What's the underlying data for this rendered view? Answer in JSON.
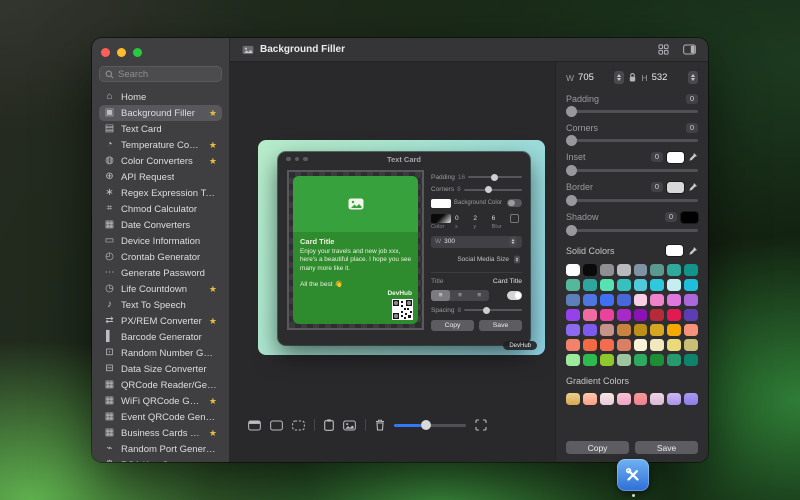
{
  "colors": {
    "accent_blue": "#3478f6",
    "star": "#e9bc3f",
    "card_green": "#2e8b2e",
    "card_green_light": "#37a13e",
    "preview_mint": "#b7ecca",
    "preview_cyan": "#8ed2e4",
    "traffic_red": "#ff5f57",
    "traffic_yellow": "#febc2e",
    "traffic_green": "#28c840"
  },
  "sidebar": {
    "search_placeholder": "Search",
    "items": [
      {
        "label": "Home",
        "icon": "home",
        "glyph": "⌂",
        "starred": false,
        "selected": false
      },
      {
        "label": "Background Filler",
        "icon": "background-filler",
        "glyph": "▣",
        "starred": true,
        "selected": true
      },
      {
        "label": "Text Card",
        "icon": "text-card",
        "glyph": "▤",
        "starred": false,
        "selected": false
      },
      {
        "label": "Temperature Converter",
        "icon": "temperature",
        "glyph": "◔",
        "starred": true,
        "selected": false
      },
      {
        "label": "Color Converters",
        "icon": "color-palette",
        "glyph": "◍",
        "starred": true,
        "selected": false
      },
      {
        "label": "API Request",
        "icon": "api-globe",
        "glyph": "⊕",
        "starred": false,
        "selected": false
      },
      {
        "label": "Regex Expression Test",
        "icon": "regex",
        "glyph": "∗",
        "starred": false,
        "selected": false
      },
      {
        "label": "Chmod Calculator",
        "icon": "chmod",
        "glyph": "⌗",
        "starred": false,
        "selected": false
      },
      {
        "label": "Date Converters",
        "icon": "calendar",
        "glyph": "▦",
        "starred": false,
        "selected": false
      },
      {
        "label": "Device Information",
        "icon": "device-monitor",
        "glyph": "▭",
        "starred": false,
        "selected": false
      },
      {
        "label": "Crontab Generator",
        "icon": "crontab-clock",
        "glyph": "◴",
        "starred": false,
        "selected": false
      },
      {
        "label": "Generate Password",
        "icon": "password-dots",
        "glyph": "⋯",
        "starred": false,
        "selected": false
      },
      {
        "label": "Life Countdown",
        "icon": "countdown-clock",
        "glyph": "◷",
        "starred": true,
        "selected": false
      },
      {
        "label": "Text To Speech",
        "icon": "speech",
        "glyph": "♪",
        "starred": false,
        "selected": false
      },
      {
        "label": "PX/REM Converter",
        "icon": "px-rem",
        "glyph": "⇄",
        "starred": true,
        "selected": false
      },
      {
        "label": "Barcode Generator",
        "icon": "barcode",
        "glyph": "▌",
        "starred": false,
        "selected": false
      },
      {
        "label": "Random Number Generator",
        "icon": "random-number",
        "glyph": "⊡",
        "starred": false,
        "selected": false
      },
      {
        "label": "Data Size Converter",
        "icon": "data-size",
        "glyph": "⊟",
        "starred": false,
        "selected": false
      },
      {
        "label": "QRCode Reader/Generator",
        "icon": "qrcode",
        "glyph": "▦",
        "starred": false,
        "selected": false
      },
      {
        "label": "WiFi QRCode Generator",
        "icon": "wifi-qrcode",
        "glyph": "▦",
        "starred": true,
        "selected": false
      },
      {
        "label": "Event QRCode Generator",
        "icon": "event-qrcode",
        "glyph": "▦",
        "starred": false,
        "selected": false
      },
      {
        "label": "Business Cards QRCode...",
        "icon": "business-qrcode",
        "glyph": "▦",
        "starred": true,
        "selected": false
      },
      {
        "label": "Random Port Generator",
        "icon": "port",
        "glyph": "⌁",
        "starred": false,
        "selected": false
      },
      {
        "label": "RSA Key Generator",
        "icon": "rsa-key",
        "glyph": "⚙",
        "starred": false,
        "selected": false
      }
    ]
  },
  "header": {
    "title": "Background Filler"
  },
  "preview": {
    "watermark": "DevHub",
    "textcard": {
      "title": "Text Card",
      "card": {
        "title": "Card Title",
        "body": "Enjoy your travels and new job xxx, here's a beautiful place. I hope you see many more like it.",
        "closing": "All the best 👋",
        "brand": "DevHub"
      },
      "controls": {
        "padding_label": "Padding",
        "padding_value": "16",
        "corners_label": "Corners",
        "corners_value": "8",
        "background_color_label": "Background Color",
        "shadow": {
          "color_label": "Color",
          "x_value": "0",
          "x_label": "x",
          "y_value": "2",
          "y_label": "y",
          "blur_value": "6",
          "blur_label": "Blur"
        },
        "width_label": "W",
        "width_value": "300",
        "size_preset": "Social Media Size",
        "title_label": "Title",
        "title_value": "Card Title",
        "align_glyph": "≡",
        "spacing_label": "Spacing",
        "spacing_value": "8",
        "copy_label": "Copy",
        "save_label": "Save"
      }
    }
  },
  "right_panel": {
    "width": {
      "label": "W",
      "value": "705"
    },
    "height": {
      "label": "H",
      "value": "532"
    },
    "controls": [
      {
        "label": "Padding",
        "value": "0"
      },
      {
        "label": "Corners",
        "value": "0"
      },
      {
        "label": "Inset",
        "value": "0",
        "swatch": "#ffffff",
        "eyedropper": true
      },
      {
        "label": "Border",
        "value": "0",
        "swatch": "#d8d8d8",
        "eyedropper": true
      },
      {
        "label": "Shadow",
        "value": "0",
        "swatch": "#000000"
      }
    ],
    "solid_colors_title": "Solid Colors",
    "solid_colors": [
      "#ffffff",
      "#0a0a0a",
      "#8f9093",
      "#b8babd",
      "#7f93a4",
      "#5a998f",
      "#2fa89e",
      "#12948a",
      "#55b89c",
      "#2da79d",
      "#55e3b2",
      "#35c2be",
      "#4fc9dc",
      "#2fc9dd",
      "#c4eef2",
      "#1fbeda",
      "#5d80ba",
      "#4e76e2",
      "#3f70f2",
      "#4867da",
      "#f9cfe6",
      "#ef82ca",
      "#de78de",
      "#aa68da",
      "#9542ea",
      "#ef6ca2",
      "#ea429e",
      "#a928ca",
      "#8d12b6",
      "#b62a3a",
      "#e21a52",
      "#5c3eb2",
      "#8c6aee",
      "#7c5aee",
      "#c69289",
      "#c8843e",
      "#be8e1a",
      "#d6a622",
      "#f4aa02",
      "#f4927a",
      "#f4826a",
      "#f26a42",
      "#f46c4e",
      "#da7e64",
      "#faf4d6",
      "#f2e8be",
      "#eada7c",
      "#c8be76",
      "#9cea9c",
      "#2eba4e",
      "#8ec82e",
      "#9ec69e",
      "#2eaa5e",
      "#1e8e36",
      "#269a6e",
      "#0e826a"
    ],
    "gradient_colors_title": "Gradient Colors",
    "gradient_colors": [
      [
        "#eccf8e",
        "#d9a84e"
      ],
      [
        "#ffc9ad",
        "#ff9d85"
      ],
      [
        "#f6e7e3",
        "#e9c9d8"
      ],
      [
        "#f9c2d2",
        "#f0a3c4"
      ],
      [
        "#f59a96",
        "#ee7f96"
      ],
      [
        "#efd6e2",
        "#d9b6d8"
      ],
      [
        "#cdb5f2",
        "#ab93e8"
      ],
      [
        "#a79af0",
        "#8c7ce8"
      ]
    ],
    "copy_label": "Copy",
    "save_label": "Save"
  },
  "dock": {
    "app": "DevHub"
  }
}
